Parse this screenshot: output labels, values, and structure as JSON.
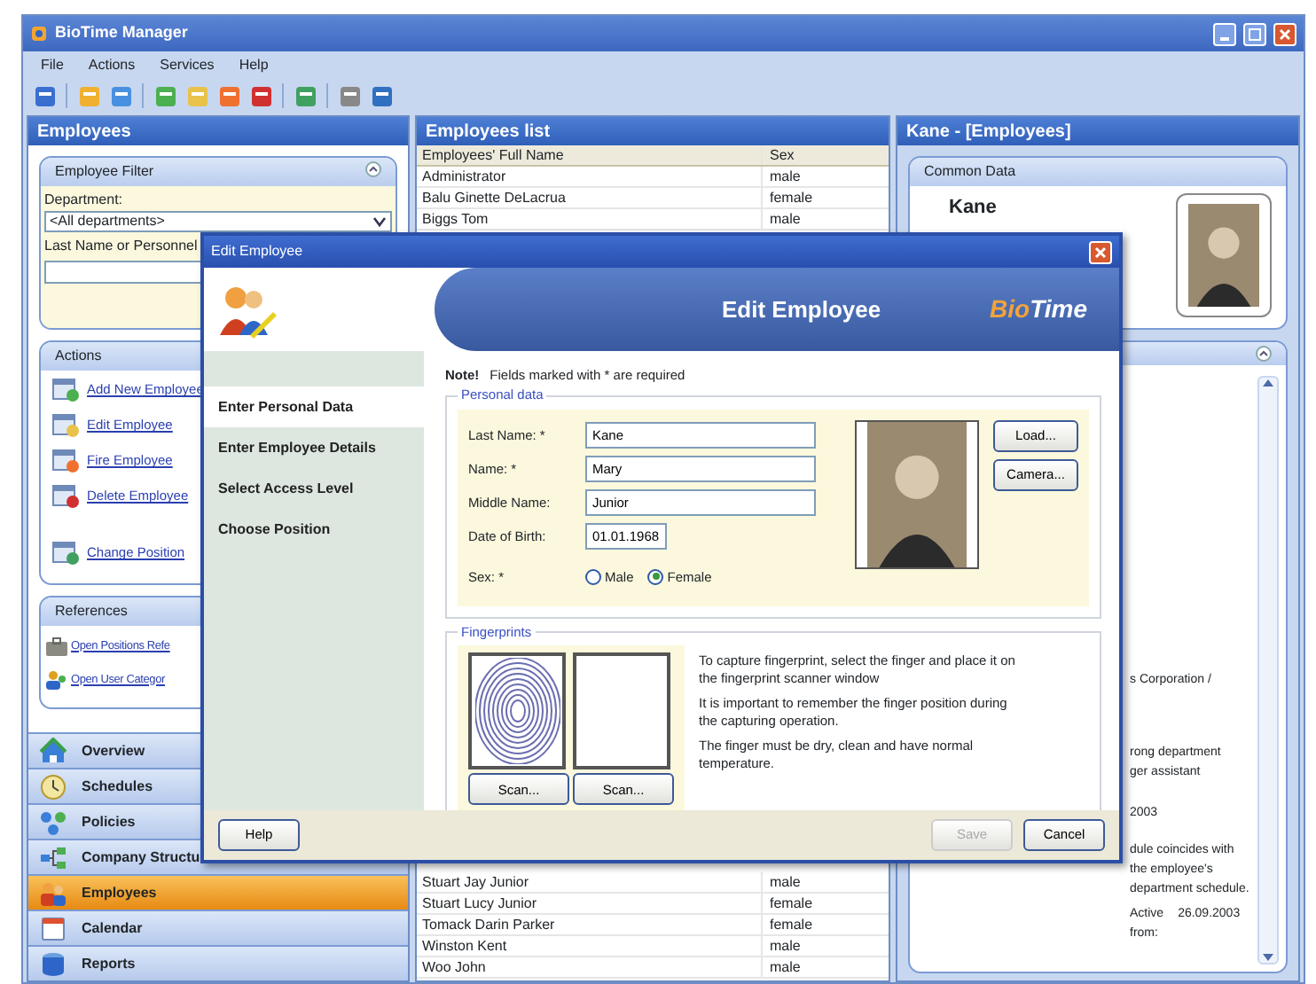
{
  "window": {
    "title": "BioTime Manager"
  },
  "menu": [
    "File",
    "Actions",
    "Services",
    "Help"
  ],
  "employees_panel": {
    "title": "Employees",
    "filter": {
      "title": "Employee Filter",
      "department_label": "Department:",
      "department_value": "<All departments>",
      "search_label": "Last Name or Personnel"
    },
    "actions": {
      "title": "Actions",
      "items": [
        "Add New Employee",
        "Edit Employee",
        "Fire Employee",
        "Delete Employee",
        "Change Position"
      ]
    },
    "references": {
      "title": "References",
      "items": [
        "Open Positions Refe",
        "Open User Categor"
      ]
    }
  },
  "navigation": [
    {
      "label": "Overview",
      "selected": false
    },
    {
      "label": "Schedules",
      "selected": false
    },
    {
      "label": "Policies",
      "selected": false
    },
    {
      "label": "Company Structu",
      "selected": false
    },
    {
      "label": "Employees",
      "selected": true
    },
    {
      "label": "Calendar",
      "selected": false
    },
    {
      "label": "Reports",
      "selected": false
    }
  ],
  "list_panel": {
    "title": "Employees list",
    "columns": [
      "Employees' Full Name",
      "Sex"
    ],
    "rows_above": [
      [
        "Administrator",
        "male"
      ],
      [
        "Balu Ginette DeLacrua",
        "female"
      ],
      [
        "Biggs Tom",
        "male"
      ]
    ],
    "rows_below": [
      [
        "Stuart Jay Junior",
        "male"
      ],
      [
        "Stuart Lucy Junior",
        "female"
      ],
      [
        "Tomack Darin Parker",
        "female"
      ],
      [
        "Winston Kent",
        "male"
      ],
      [
        "Woo John",
        "male"
      ]
    ]
  },
  "detail_panel": {
    "title": "Kane - [Employees]",
    "common_data": {
      "title": "Common Data",
      "name": "Kane"
    },
    "details": [
      {
        "text": "s Corporation /"
      },
      {
        "text": "rong department"
      },
      {
        "text": "ger assistant"
      },
      {
        "text": "2003"
      },
      {
        "text": "dule coincides with"
      },
      {
        "text": "the employee's"
      },
      {
        "text": "department schedule."
      },
      {
        "text": "Active",
        "value": "26.09.2003"
      },
      {
        "text": "from:"
      }
    ]
  },
  "dialog": {
    "title": "Edit Employee",
    "header": "Edit Employee",
    "logo": [
      "Bio",
      "Time"
    ],
    "steps": [
      {
        "label": "Enter Personal Data",
        "selected": true
      },
      {
        "label": "Enter Employee Details",
        "selected": false
      },
      {
        "label": "Select Access Level",
        "selected": false
      },
      {
        "label": "Choose Position",
        "selected": false
      }
    ],
    "note_label": "Note!",
    "note": "Fields marked with * are required",
    "personal_data": {
      "title": "Personal data",
      "fields": [
        {
          "label": "Last Name: *",
          "value": "Kane"
        },
        {
          "label": "Name: *",
          "value": "Mary"
        },
        {
          "label": "Middle Name:",
          "value": "Junior"
        },
        {
          "label": "Date of Birth:",
          "value": "01.01.1968"
        }
      ],
      "sex_label": "Sex: *",
      "sex_options": [
        {
          "label": "Male",
          "selected": false
        },
        {
          "label": "Female",
          "selected": true
        }
      ],
      "photo_buttons": [
        "Load...",
        "Camera..."
      ]
    },
    "fingerprints": {
      "title": "Fingerprints",
      "slots": [
        {
          "captured": true,
          "button": "Scan..."
        },
        {
          "captured": false,
          "button": "Scan..."
        }
      ],
      "instructions": [
        "To capture fingerprint, select the finger and place it on the fingerprint scanner window",
        "It is important to remember the finger position during the capturing operation.",
        "The finger must be dry, clean and have normal temperature."
      ]
    },
    "buttons": [
      {
        "label": "Help",
        "disabled": false
      },
      {
        "label": "Save",
        "disabled": true
      },
      {
        "label": "Cancel",
        "disabled": false
      }
    ]
  }
}
